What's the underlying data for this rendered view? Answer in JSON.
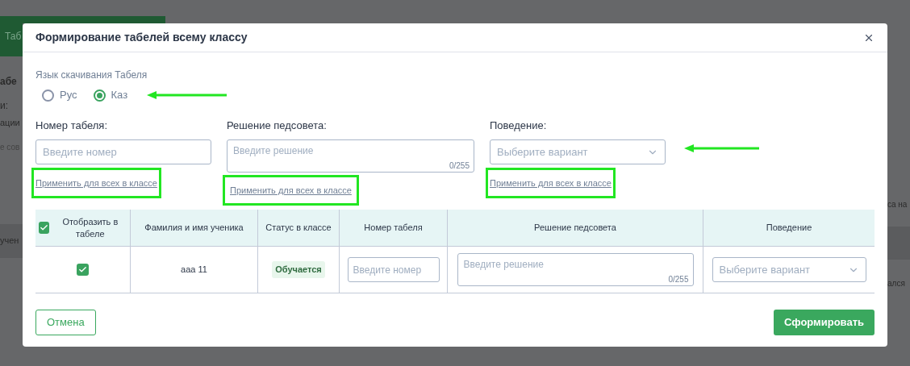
{
  "background": {
    "button": "Таб",
    "left_texts": [
      "абе",
      "и:",
      "ации",
      "е сов"
    ],
    "left_bar": "учен",
    "right_texts": [
      "са на",
      "ался"
    ]
  },
  "dialog": {
    "title": "Формирование табелей всему классу"
  },
  "language": {
    "label": "Язык скачивания Табеля",
    "annotated": true,
    "options": [
      {
        "label": "Рус",
        "selected": false
      },
      {
        "label": "Каз",
        "selected": true
      }
    ]
  },
  "fields": [
    {
      "kind": "input",
      "label": "Номер табеля:",
      "placeholder": "Введите номер",
      "apply_link": "Применить для всех в классе",
      "highlighted": true
    },
    {
      "kind": "textarea",
      "label": "Решение педсовета:",
      "placeholder": "Введите решение",
      "counter": "0/255",
      "apply_link": "Применить для всех в классе",
      "highlighted": true
    },
    {
      "kind": "select",
      "label": "Поведение:",
      "placeholder": "Выберите вариант",
      "apply_link": "Применить для всех в классе",
      "highlighted": true,
      "annotated": true
    }
  ],
  "table": {
    "select_all": {
      "checked": true
    },
    "columns": [
      "Отобразить в табеле",
      "Фамилия и имя ученика",
      "Статус в классе",
      "Номер табеля",
      "Решение педсовета",
      "Поведение"
    ],
    "rows": [
      {
        "checked": true,
        "name": "ааа 11",
        "status": "Обучается",
        "number_placeholder": "Введите номер",
        "decision_placeholder": "Введите решение",
        "decision_counter": "0/255",
        "behavior_placeholder": "Выберите вариант"
      }
    ]
  },
  "buttons": [
    {
      "kind": "outline",
      "label": "Отмена"
    },
    {
      "kind": "primary",
      "label": "Сформировать"
    }
  ]
}
